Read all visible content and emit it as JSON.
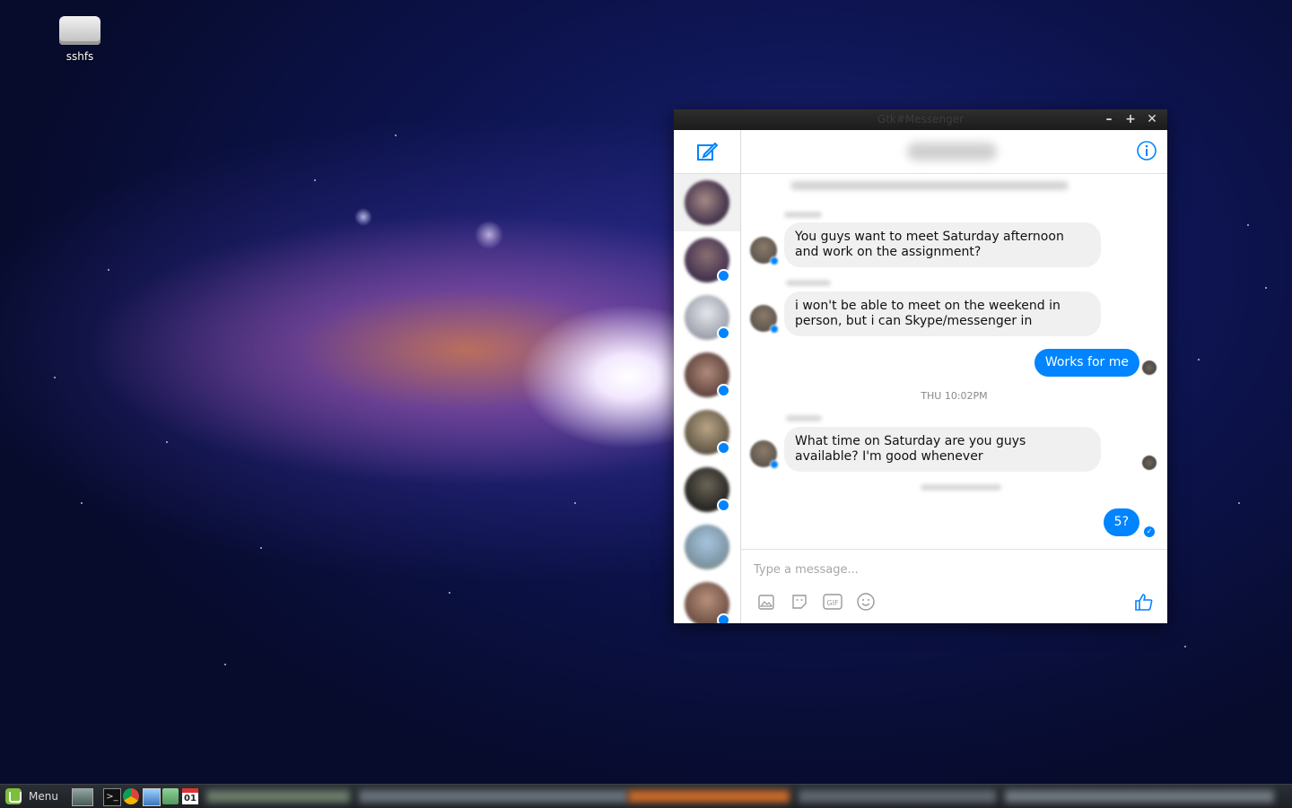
{
  "desktop": {
    "icon_label": "sshfs"
  },
  "window": {
    "title": "Gtk#Messenger",
    "minimize": "–",
    "maximize": "+",
    "close": "✕"
  },
  "sidebar": {
    "compose_icon": "compose-icon"
  },
  "header": {
    "info_icon": "info-icon"
  },
  "messages": {
    "m1": "You guys want to meet Saturday afternoon and work on the assignment?",
    "m2": "i won't be able to meet on the weekend in person, but i can Skype/messenger in",
    "m3": "Works for me",
    "timestamp": "THU 10:02PM",
    "m4": "What time on Saturday are you guys available? I'm good whenever",
    "m5": "5?"
  },
  "composer": {
    "placeholder": "Type a message...",
    "tools": [
      "photo-icon",
      "sticker-icon",
      "gif-icon",
      "emoji-icon"
    ],
    "like_icon": "thumbs-up-icon"
  },
  "taskbar": {
    "menu_label": "Menu",
    "calendar_day": "01"
  },
  "colors": {
    "accent": "#0084ff",
    "incoming_bubble": "#f1f0f0",
    "titlebar": "#1b1b1b"
  }
}
